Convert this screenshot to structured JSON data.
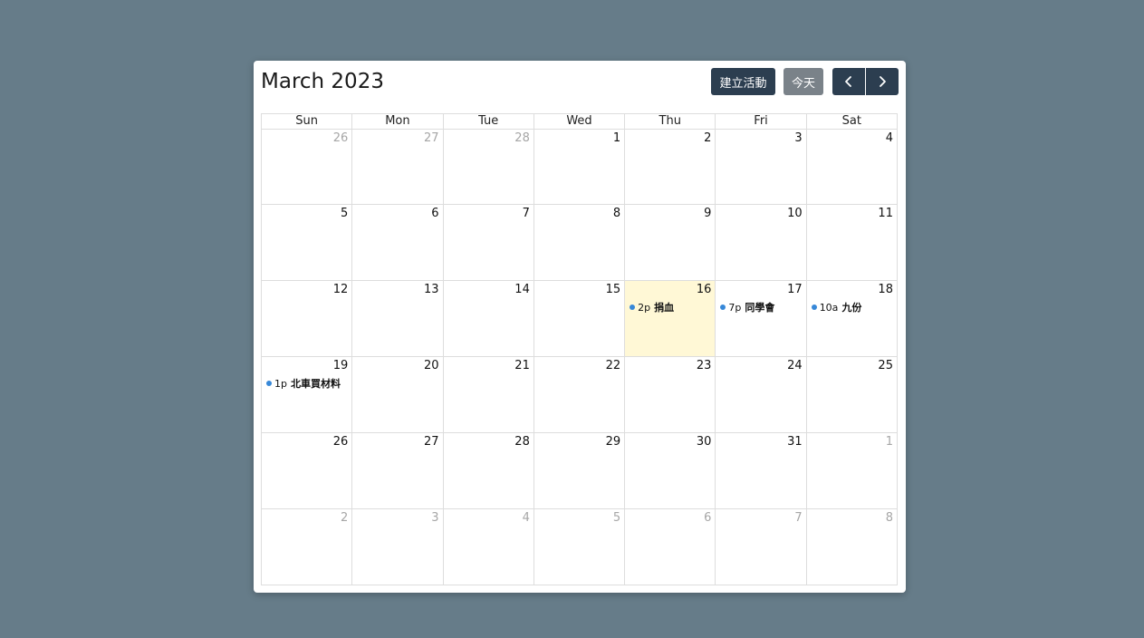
{
  "calendar": {
    "title": "March 2023",
    "buttons": {
      "create": "建立活動",
      "today": "今天",
      "prev_icon": "chevron-left-icon",
      "next_icon": "chevron-right-icon"
    },
    "weekdays": [
      "Sun",
      "Mon",
      "Tue",
      "Wed",
      "Thu",
      "Fri",
      "Sat"
    ],
    "weeks": [
      [
        {
          "num": "26",
          "other": true
        },
        {
          "num": "27",
          "other": true
        },
        {
          "num": "28",
          "other": true
        },
        {
          "num": "1"
        },
        {
          "num": "2"
        },
        {
          "num": "3"
        },
        {
          "num": "4"
        }
      ],
      [
        {
          "num": "5"
        },
        {
          "num": "6"
        },
        {
          "num": "7"
        },
        {
          "num": "8"
        },
        {
          "num": "9"
        },
        {
          "num": "10"
        },
        {
          "num": "11"
        }
      ],
      [
        {
          "num": "12"
        },
        {
          "num": "13"
        },
        {
          "num": "14"
        },
        {
          "num": "15"
        },
        {
          "num": "16",
          "today": true,
          "events": [
            {
              "time": "2p",
              "title": "捐血"
            }
          ]
        },
        {
          "num": "17",
          "events": [
            {
              "time": "7p",
              "title": "同學會"
            }
          ]
        },
        {
          "num": "18",
          "events": [
            {
              "time": "10a",
              "title": "九份"
            }
          ]
        }
      ],
      [
        {
          "num": "19",
          "events": [
            {
              "time": "1p",
              "title": "北車買材料"
            }
          ]
        },
        {
          "num": "20"
        },
        {
          "num": "21"
        },
        {
          "num": "22"
        },
        {
          "num": "23"
        },
        {
          "num": "24"
        },
        {
          "num": "25"
        }
      ],
      [
        {
          "num": "26"
        },
        {
          "num": "27"
        },
        {
          "num": "28"
        },
        {
          "num": "29"
        },
        {
          "num": "30"
        },
        {
          "num": "31"
        },
        {
          "num": "1",
          "other": true
        }
      ],
      [
        {
          "num": "2",
          "other": true
        },
        {
          "num": "3",
          "other": true
        },
        {
          "num": "4",
          "other": true
        },
        {
          "num": "5",
          "other": true
        },
        {
          "num": "6",
          "other": true
        },
        {
          "num": "7",
          "other": true
        },
        {
          "num": "8",
          "other": true
        }
      ]
    ]
  },
  "colors": {
    "background": "#667c89",
    "primary_button": "#2c3e50",
    "today_button": "#6c757d",
    "today_cell": "#fff8d6",
    "event_dot": "#3788d8"
  }
}
